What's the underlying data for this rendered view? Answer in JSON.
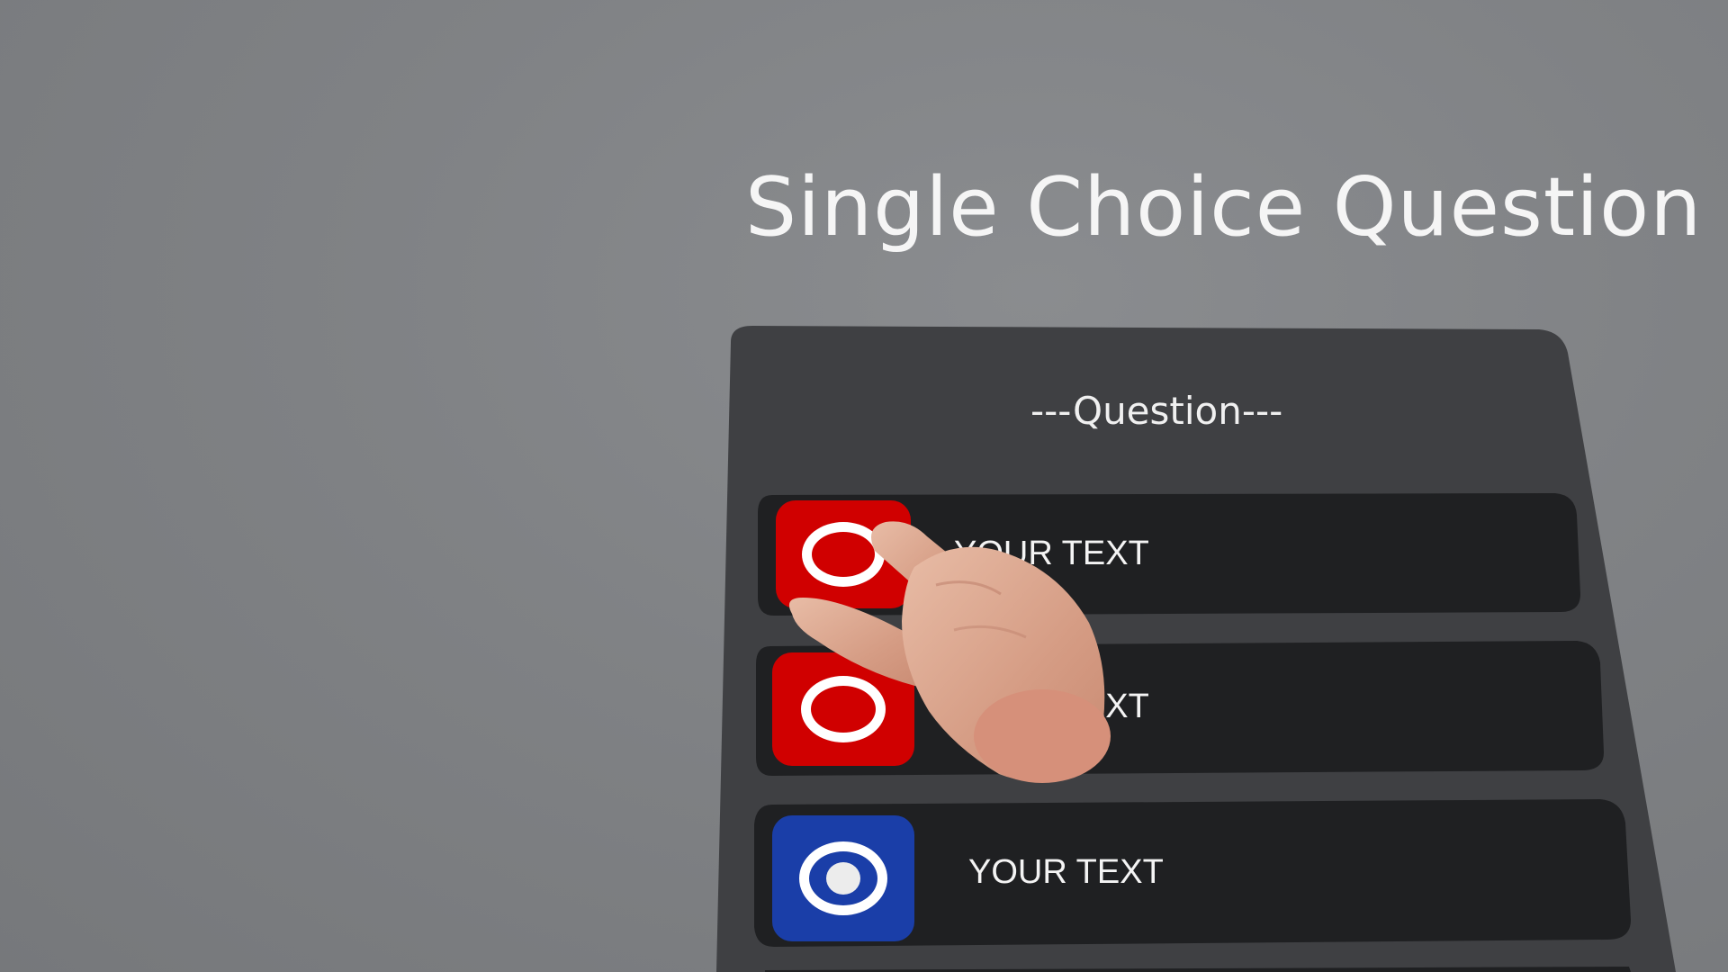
{
  "scene": {
    "title": "Single Choice Question",
    "question": "---Question---"
  },
  "options": [
    {
      "label": "YOUR TEXT",
      "selected": false,
      "color": "#d00000"
    },
    {
      "label": "YOUR TEXT",
      "selected": false,
      "color": "#d00000"
    },
    {
      "label": "YOUR TEXT",
      "selected": true,
      "color": "#1a3ea8"
    }
  ],
  "colors": {
    "background": "#808285",
    "panel": "#3f4043",
    "option_row": "#1f2022",
    "unselected_button": "#d00000",
    "selected_button": "#1a3ea8",
    "text": "#f4f4f4"
  },
  "icons": {
    "unselected": "radio-ring-icon",
    "selected": "radio-dot-icon",
    "hand": "pointing-hand"
  }
}
